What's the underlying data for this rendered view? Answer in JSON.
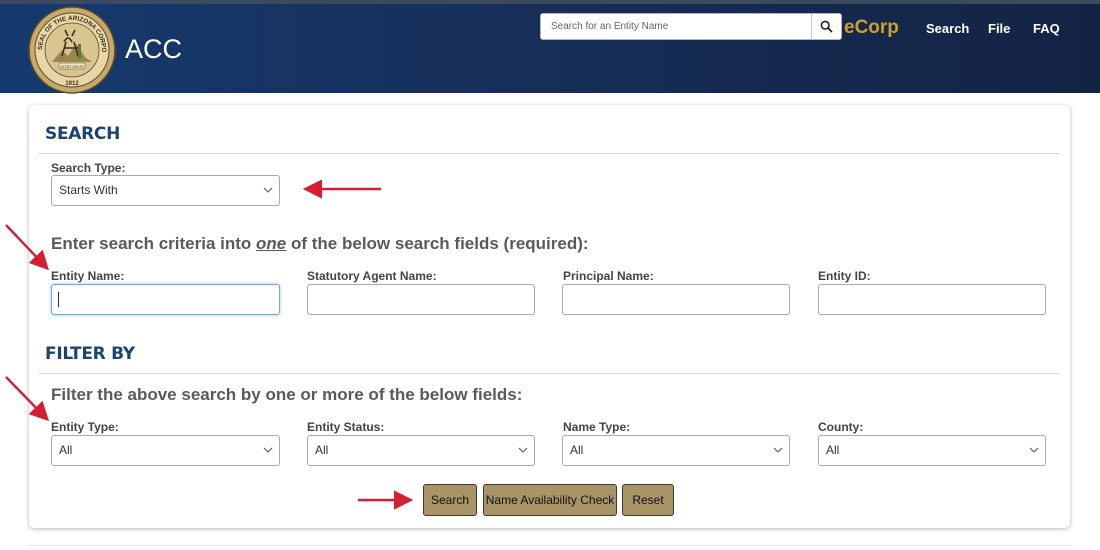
{
  "header": {
    "title": "ACC",
    "seal_text_top": "SEAL OF THE ARIZONA CORPORATION COMMISSION",
    "seal_motto": "DITAT DEUS",
    "seal_year": "1912",
    "search_placeholder": "Search for an Entity Name",
    "brand": "eCorp",
    "nav": [
      "Search",
      "File",
      "FAQ"
    ]
  },
  "search_section": {
    "title": "SEARCH",
    "search_type_label": "Search Type:",
    "search_type_value": "Starts With",
    "prompt_before": "Enter search criteria into ",
    "prompt_emph": "one",
    "prompt_after": " of the below search fields (required):",
    "fields": [
      {
        "label": "Entity Name:"
      },
      {
        "label": "Statutory Agent Name:"
      },
      {
        "label": "Principal Name:"
      },
      {
        "label": "Entity ID:"
      }
    ]
  },
  "filter_section": {
    "title": "FILTER BY",
    "prompt": "Filter the above search by one or more of the below fields:",
    "filters": [
      {
        "label": "Entity Type:",
        "value": "All"
      },
      {
        "label": "Entity Status:",
        "value": "All"
      },
      {
        "label": "Name Type:",
        "value": "All"
      },
      {
        "label": "County:",
        "value": "All"
      }
    ]
  },
  "buttons": {
    "search": "Search",
    "name_check": "Name Availability Check",
    "reset": "Reset"
  },
  "colors": {
    "header": "#17305c",
    "brand": "#c9a227",
    "section_title": "#1d4470",
    "button": "#a89466",
    "annotation_arrow": "#d41f33"
  }
}
